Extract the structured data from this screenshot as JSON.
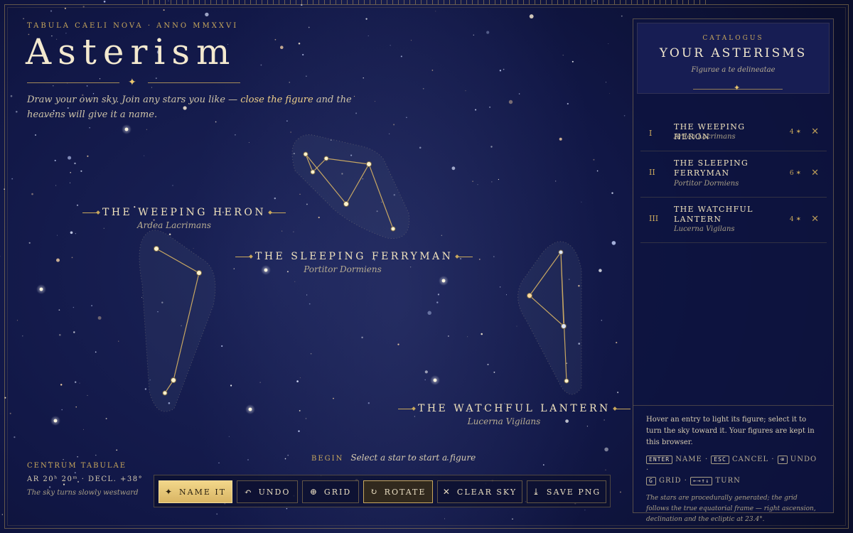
{
  "header": {
    "eyebrow": "TABULA CAELI NOVA · ANNO MMXXVI",
    "title": "Asterism",
    "intro_before": "Draw your own sky. Join any stars you like — ",
    "intro_highlight": "close the figure",
    "intro_after": " and the heavens will give it a name."
  },
  "constellations": [
    {
      "name": "THE WEEPING HERON",
      "latin": "Ardea Lacrimans"
    },
    {
      "name": "THE SLEEPING FERRYMAN",
      "latin": "Portitor Dormiens"
    },
    {
      "name": "THE WATCHFUL LANTERN",
      "latin": "Lucerna Vigilans"
    }
  ],
  "centrum": {
    "heading": "CENTRUM TABULAE",
    "coords": "AR 20ʰ 20ᵐ · DECL. +38°",
    "note": "The sky turns slowly westward"
  },
  "hint": {
    "label": "BEGIN",
    "text": "Select a star to start a figure"
  },
  "toolbar": {
    "name_it": "NAME IT",
    "undo": "UNDO",
    "grid": "GRID",
    "rotate": "ROTATE",
    "clear": "CLEAR SKY",
    "save": "SAVE PNG"
  },
  "icons": {
    "name_it": "sparkle-icon",
    "undo": "undo-arrow-icon",
    "grid": "globe-grid-icon",
    "rotate": "rotate-icon",
    "clear": "close-icon",
    "save": "download-icon"
  },
  "panel": {
    "catalogus": "CATALOGUS",
    "title": "YOUR ASTERISMS",
    "subtitle": "Figurae a te delineatae",
    "items": [
      {
        "num": "I",
        "name": "THE WEEPING HERON",
        "latin": "Ardea Lacrimans",
        "count": "4 ✶"
      },
      {
        "num": "II",
        "name": "THE SLEEPING FERRYMAN",
        "latin": "Portitor Dormiens",
        "count": "6 ✶"
      },
      {
        "num": "III",
        "name": "THE WATCHFUL LANTERN",
        "latin": "Lucerna Vigilans",
        "count": "4 ✶"
      }
    ],
    "help": "Hover an entry to light its figure; select it to turn the sky toward it. Your figures are kept in this browser.",
    "keys": {
      "enter_key": "ENTER",
      "enter_label": "NAME",
      "esc_key": "ESC",
      "esc_label": "CANCEL",
      "undo_key": "⌫",
      "undo_label": "UNDO",
      "grid_key": "G",
      "grid_label": "GRID",
      "turn_key": "←→↑↓",
      "turn_label": "TURN"
    },
    "note": "The stars are procedurally generated; the grid follows the true equatorial frame — right ascension, declination and the ecliptic at 23.4°."
  },
  "colors": {
    "gold": "#c9a85c",
    "sky": "#111746",
    "line": "#d9b564"
  }
}
